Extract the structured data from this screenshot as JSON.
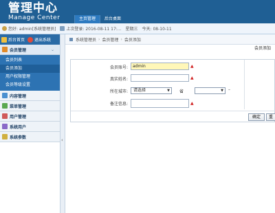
{
  "header": {
    "title_cn": "管理中心",
    "title_en": "Manage Center",
    "nav": [
      "主页管理",
      "后台桌面"
    ]
  },
  "status": {
    "user": "您好: admin[系统管理员]",
    "last_login": "上次登录: 2016-08-11 17:...",
    "week": "星期三",
    "today": "今天: 08-10-11"
  },
  "sidebar": {
    "quick": [
      {
        "label": "后台首页",
        "icon": "home-icon"
      },
      {
        "label": "退出系统",
        "icon": "exit-icon"
      }
    ],
    "groups": [
      {
        "label": "会员管理",
        "icon": "members-icon",
        "open": true,
        "items": [
          "会员列表",
          "会员添加",
          "用户权限管理",
          "会员等级设置"
        ]
      },
      {
        "label": "内容管理",
        "icon": "content-icon"
      },
      {
        "label": "菜单管理",
        "icon": "menu-icon"
      },
      {
        "label": "用户管理",
        "icon": "users-icon"
      },
      {
        "label": "系统用户",
        "icon": "system-user-icon"
      },
      {
        "label": "系统参数",
        "icon": "settings-icon"
      }
    ]
  },
  "breadcrumb": [
    "系统管理员",
    "会员管理",
    "会员添加"
  ],
  "toolbar": {
    "title": "会员添加"
  },
  "form": {
    "username_label": "会员账号:",
    "username_value": "admin",
    "realname_label": "真实姓名:",
    "region_label": "所在城市:",
    "province_value": "请选择",
    "province_suffix": "省",
    "city_value": "",
    "remark_label": "备注信息:",
    "submit_label": "确定",
    "reset_label": "重置"
  },
  "colors": {
    "header_bg": "#1f5f94",
    "submenu_bg": "#2d73b3",
    "highlight_input": "#fff7b8",
    "required": "#d02020"
  }
}
